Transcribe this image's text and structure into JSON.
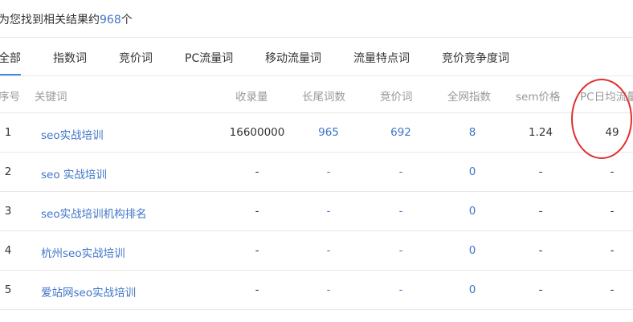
{
  "summary": {
    "prefix": "为您找到相关结果约",
    "count": "968",
    "suffix": "个"
  },
  "tabs": [
    "全部",
    "指数词",
    "竞价词",
    "PC流量词",
    "移动流量词",
    "流量特点词",
    "竞价竞争度词"
  ],
  "active_tab": "全部",
  "headers": [
    "序号",
    "关键词",
    "收录量",
    "长尾词数",
    "竞价词",
    "全网指数",
    "sem价格",
    "PC日均流量"
  ],
  "rows": [
    {
      "idx": "1",
      "kw": "seo实战培训",
      "shoulu": "16600000",
      "changwei": "965",
      "jingjia": "692",
      "index": "8",
      "sem": "1.24",
      "pc": "49"
    },
    {
      "idx": "2",
      "kw": "seo 实战培训",
      "shoulu": "-",
      "changwei": "-",
      "jingjia": "-",
      "index": "0",
      "sem": "-",
      "pc": "-"
    },
    {
      "idx": "3",
      "kw": "seo实战培训机构排名",
      "shoulu": "-",
      "changwei": "-",
      "jingjia": "-",
      "index": "0",
      "sem": "-",
      "pc": "-"
    },
    {
      "idx": "4",
      "kw": "杭州seo实战培训",
      "shoulu": "-",
      "changwei": "-",
      "jingjia": "-",
      "index": "0",
      "sem": "-",
      "pc": "-"
    },
    {
      "idx": "5",
      "kw": "爱站网seo实战培训",
      "shoulu": "-",
      "changwei": "-",
      "jingjia": "-",
      "index": "0",
      "sem": "-",
      "pc": "-"
    }
  ],
  "colors": {
    "link": "#3f75c8",
    "highlight": "#e03030"
  }
}
